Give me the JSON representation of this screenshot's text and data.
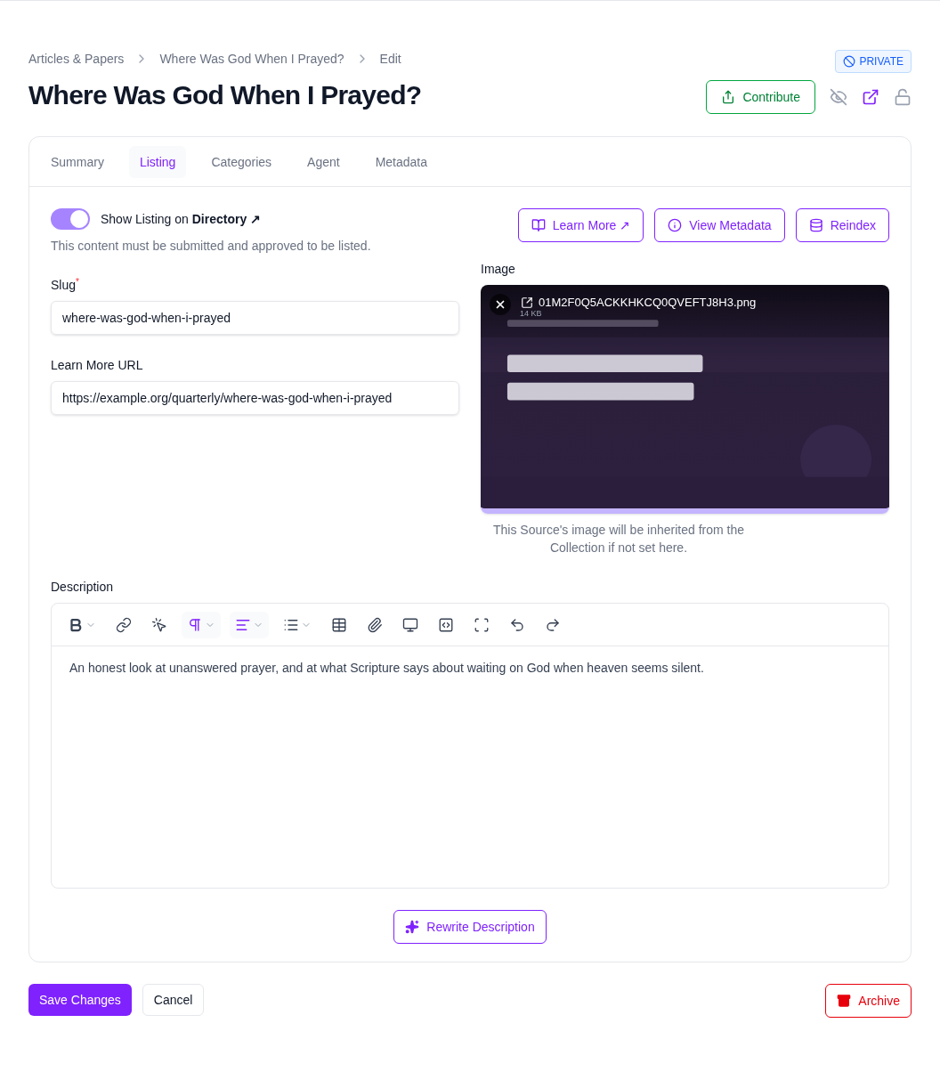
{
  "breadcrumbs": [
    "Articles & Papers",
    "Where Was God When I Prayed?",
    "Edit"
  ],
  "visibility_badge": "PRIVATE",
  "title": "Where Was God When I Prayed?",
  "contribute_button": "Contribute",
  "tabs": [
    {
      "label": "Summary",
      "selected": false
    },
    {
      "label": "Listing",
      "selected": true
    },
    {
      "label": "Categories",
      "selected": false
    },
    {
      "label": "Agent",
      "selected": false
    },
    {
      "label": "Metadata",
      "selected": false
    }
  ],
  "listing_toggle": {
    "label": "Show Listing on **Directory ↗**",
    "on": true,
    "hint": "This content must be submitted and approved to be listed."
  },
  "actions": [
    {
      "kind": "book",
      "label": "Learn More ↗"
    },
    {
      "kind": "info",
      "label": "View Metadata"
    },
    {
      "kind": "database",
      "label": "Reindex"
    }
  ],
  "slug": {
    "label": "Slug",
    "required_mark": "*",
    "value": "where-was-god-when-i-prayed"
  },
  "learn_more_url": {
    "label": "Learn More URL",
    "value": "https://example.org/quarterly/where-was-god-when-i-prayed"
  },
  "image": {
    "label": "Image",
    "file_name": "01M2F0Q5ACKKHKCQ0QVEFTJ8H3.png",
    "file_size": "14 KB",
    "hint": "This Source's image will be inherited from the Collection if not set here."
  },
  "description": {
    "label": "Description",
    "text": "An honest look at unanswered prayer, and at what Scripture says about waiting on God when heaven seems silent.",
    "toolbar": [
      {
        "kind": "bold",
        "active": false,
        "dropdown": true
      },
      {
        "kind": "link",
        "active": false,
        "dropdown": false
      },
      {
        "kind": "pointer",
        "active": false,
        "dropdown": false
      },
      {
        "kind": "paragraph",
        "active": true,
        "dropdown": true
      },
      {
        "kind": "align",
        "active": true,
        "dropdown": true
      },
      {
        "kind": "list",
        "active": false,
        "dropdown": true
      },
      {
        "kind": "table",
        "active": false,
        "dropdown": false
      },
      {
        "kind": "attach",
        "active": false,
        "dropdown": false
      },
      {
        "kind": "monitor",
        "active": false,
        "dropdown": false
      },
      {
        "kind": "code",
        "active": false,
        "dropdown": false
      },
      {
        "kind": "fullscreen",
        "active": false,
        "dropdown": false
      },
      {
        "kind": "undo",
        "active": false,
        "dropdown": false
      },
      {
        "kind": "redo",
        "active": false,
        "dropdown": false
      }
    ]
  },
  "rewrite_button": "Rewrite Description",
  "footer": {
    "save": "Save Changes",
    "cancel": "Cancel",
    "archive": "Archive"
  }
}
